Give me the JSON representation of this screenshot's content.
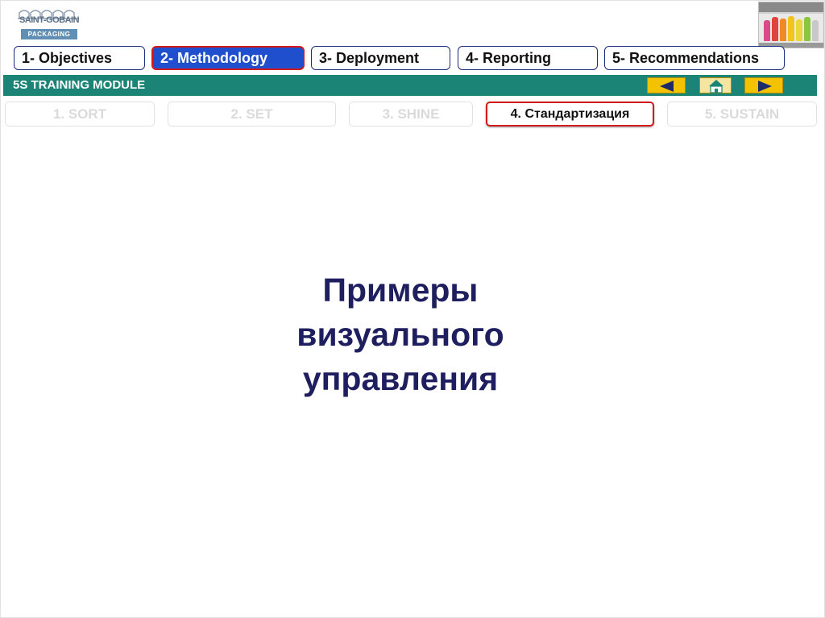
{
  "logo": {
    "name": "SAINT-GOBAIN",
    "sub": "PACKAGING"
  },
  "tabs": [
    {
      "label": "1- Objectives"
    },
    {
      "label": "2- Methodology"
    },
    {
      "label": "3- Deployment"
    },
    {
      "label": "4- Reporting"
    },
    {
      "label": "5- Recommendations"
    }
  ],
  "active_tab": "2- Methodology",
  "module_bar": {
    "title": "5S TRAINING MODULE",
    "prev_icon": "triangle-left-icon",
    "home_icon": "home-icon",
    "next_icon": "triangle-right-icon"
  },
  "steps": [
    {
      "label": "1. SORT"
    },
    {
      "label": "2. SET"
    },
    {
      "label": "3. SHINE"
    },
    {
      "label": "4. Стандартизация"
    },
    {
      "label": "5. SUSTAIN"
    }
  ],
  "active_step": "4. Стандартизация",
  "heading": "Примеры\nвизуального\nуправления",
  "colors": {
    "navy": "#1c2b7a",
    "active_tab_fill": "#1f4fcc",
    "active_border": "#d31a1a",
    "module_bar": "#1b8477",
    "nav_button": "#f3c200",
    "heading_text": "#1f1f5f",
    "inactive_step_text": "#dadada"
  }
}
